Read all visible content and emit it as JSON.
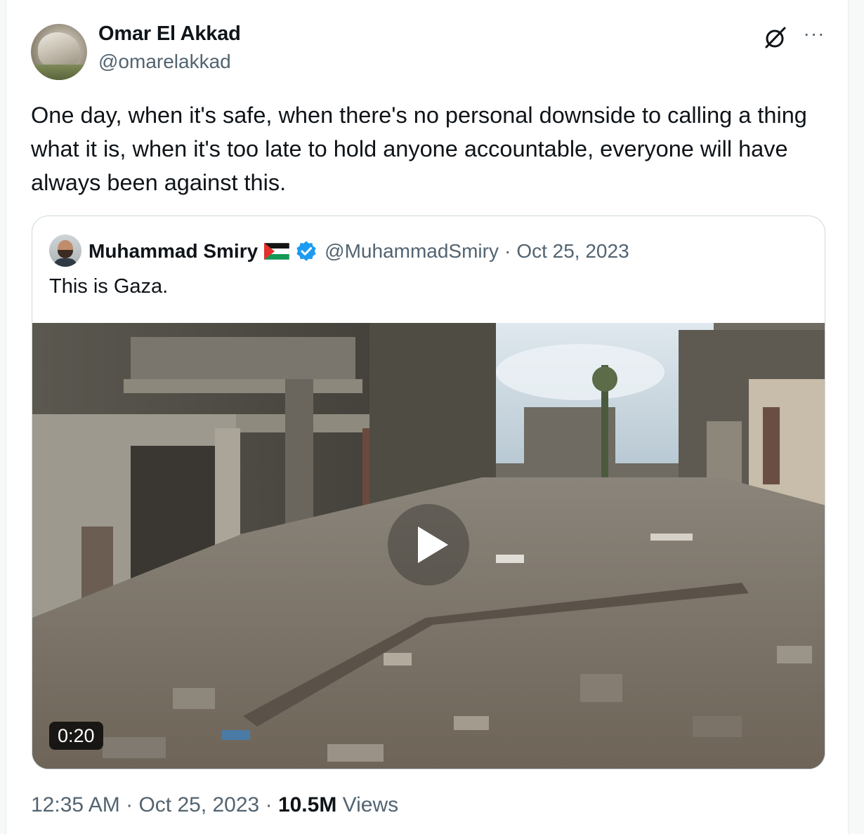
{
  "author": {
    "name": "Omar El Akkad",
    "handle": "@omarelakkad"
  },
  "header_icons": {
    "grok": "grok-icon",
    "more": "more-icon",
    "more_glyph": "···"
  },
  "tweet": {
    "text": "One day, when it's safe, when there's no personal downside to calling a thing what it is, when it's too late to hold anyone accountable, everyone will have always been against this."
  },
  "quoted": {
    "name": "Muhammad Smiry",
    "flag": "palestine-flag",
    "verified": "verified-badge-icon",
    "handle": "@MuhammadSmiry",
    "separator": "·",
    "date": "Oct 25, 2023",
    "text": "This is Gaza.",
    "video": {
      "duration": "0:20",
      "play": "play-icon"
    }
  },
  "footer": {
    "time": "12:35 AM",
    "date": "Oct 25, 2023",
    "separator": "·",
    "views_count": "10.5M",
    "views_label": "Views"
  },
  "colors": {
    "text": "#0f1419",
    "secondary": "#536471",
    "border": "#cfd9de",
    "verified": "#1d9bf0"
  }
}
